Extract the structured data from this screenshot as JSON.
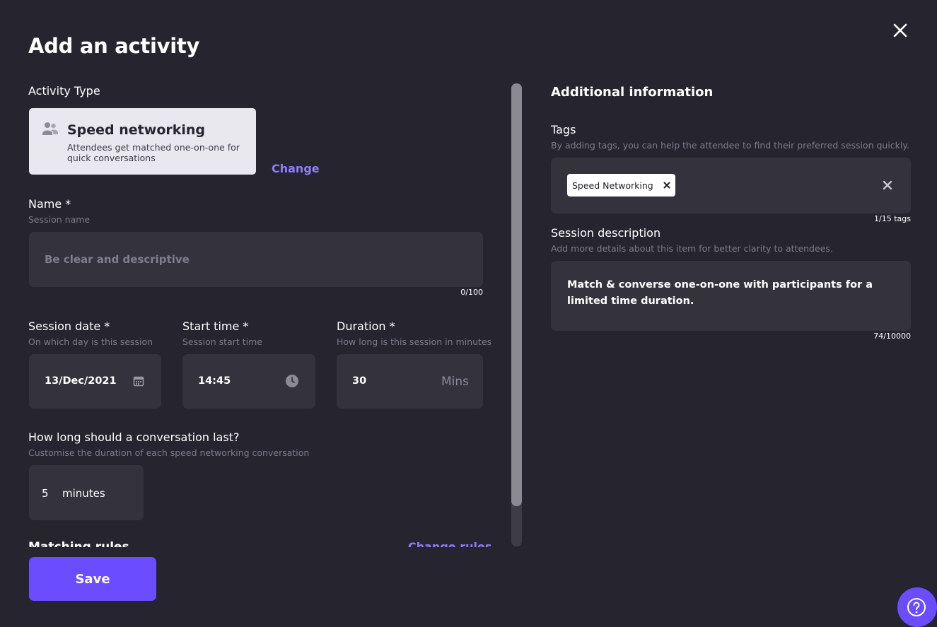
{
  "dialog": {
    "title": "Add an activity",
    "close_icon": "close-icon"
  },
  "activity_type": {
    "label": "Activity Type",
    "name": "Speed networking",
    "description": "Attendees get matched one-on-one for quick conversations",
    "icon": "people-icon",
    "change_label": "Change"
  },
  "name_field": {
    "label": "Name *",
    "hint": "Session name",
    "placeholder": "Be clear and descriptive",
    "value": "",
    "counter": "0/100"
  },
  "session_date": {
    "label": "Session date *",
    "hint": "On which day is this session",
    "value": "13/Dec/2021",
    "icon": "calendar-icon"
  },
  "start_time": {
    "label": "Start time *",
    "hint": "Session start time",
    "value": "14:45",
    "icon": "clock-icon"
  },
  "duration": {
    "label": "Duration *",
    "hint": "How long is this session in minutes",
    "value": "30",
    "unit": "Mins"
  },
  "conversation": {
    "label": "How long should a conversation last?",
    "hint": "Customise the duration of each speed networking conversation",
    "value": "5",
    "unit": "minutes"
  },
  "matching": {
    "label": "Matching rules",
    "change_label": "Change rules"
  },
  "save_label": "Save",
  "additional": {
    "title": "Additional information",
    "tags": {
      "label": "Tags",
      "hint": "By adding tags, you can help the attendee to find their preferred session quickly.",
      "items": [
        "Speed Networking"
      ],
      "counter": "1/15 tags"
    },
    "description": {
      "label": "Session description",
      "hint": "Add more details about this item for better clarity to attendees.",
      "value": "Match & converse one-on-one with participants for a limited time duration.",
      "counter": "74/10000"
    }
  },
  "colors": {
    "background": "#26252f",
    "field": "#33323d",
    "accent": "#6b4cff",
    "link": "#8e7cff"
  }
}
